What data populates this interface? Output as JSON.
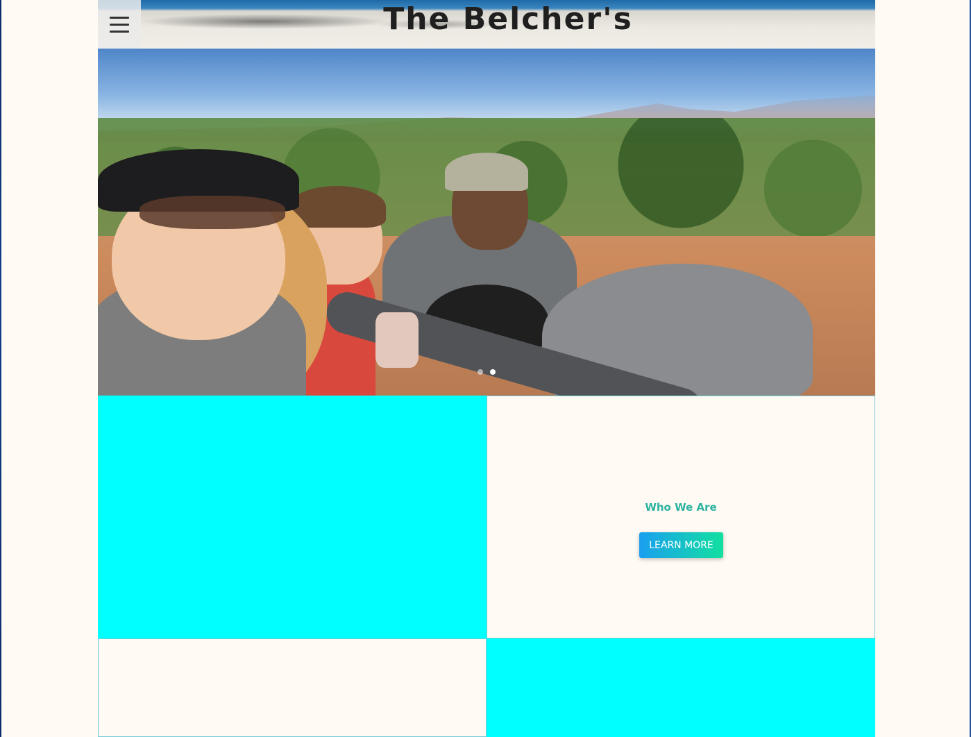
{
  "header": {
    "title": "The Belcher's",
    "menu_icon": "hamburger-menu-icon"
  },
  "hero": {
    "carousel_dots": 2,
    "active_dot": 1
  },
  "sections": {
    "who_we_are": {
      "title": "Who We Are",
      "button_label": "LEARN MORE"
    }
  },
  "colors": {
    "page_background": "#fffaf3",
    "tile_cyan": "#00ffff",
    "accent_text": "#2cb3a0",
    "button_gradient_start": "#1a9ff0",
    "button_gradient_end": "#12e0a0"
  }
}
